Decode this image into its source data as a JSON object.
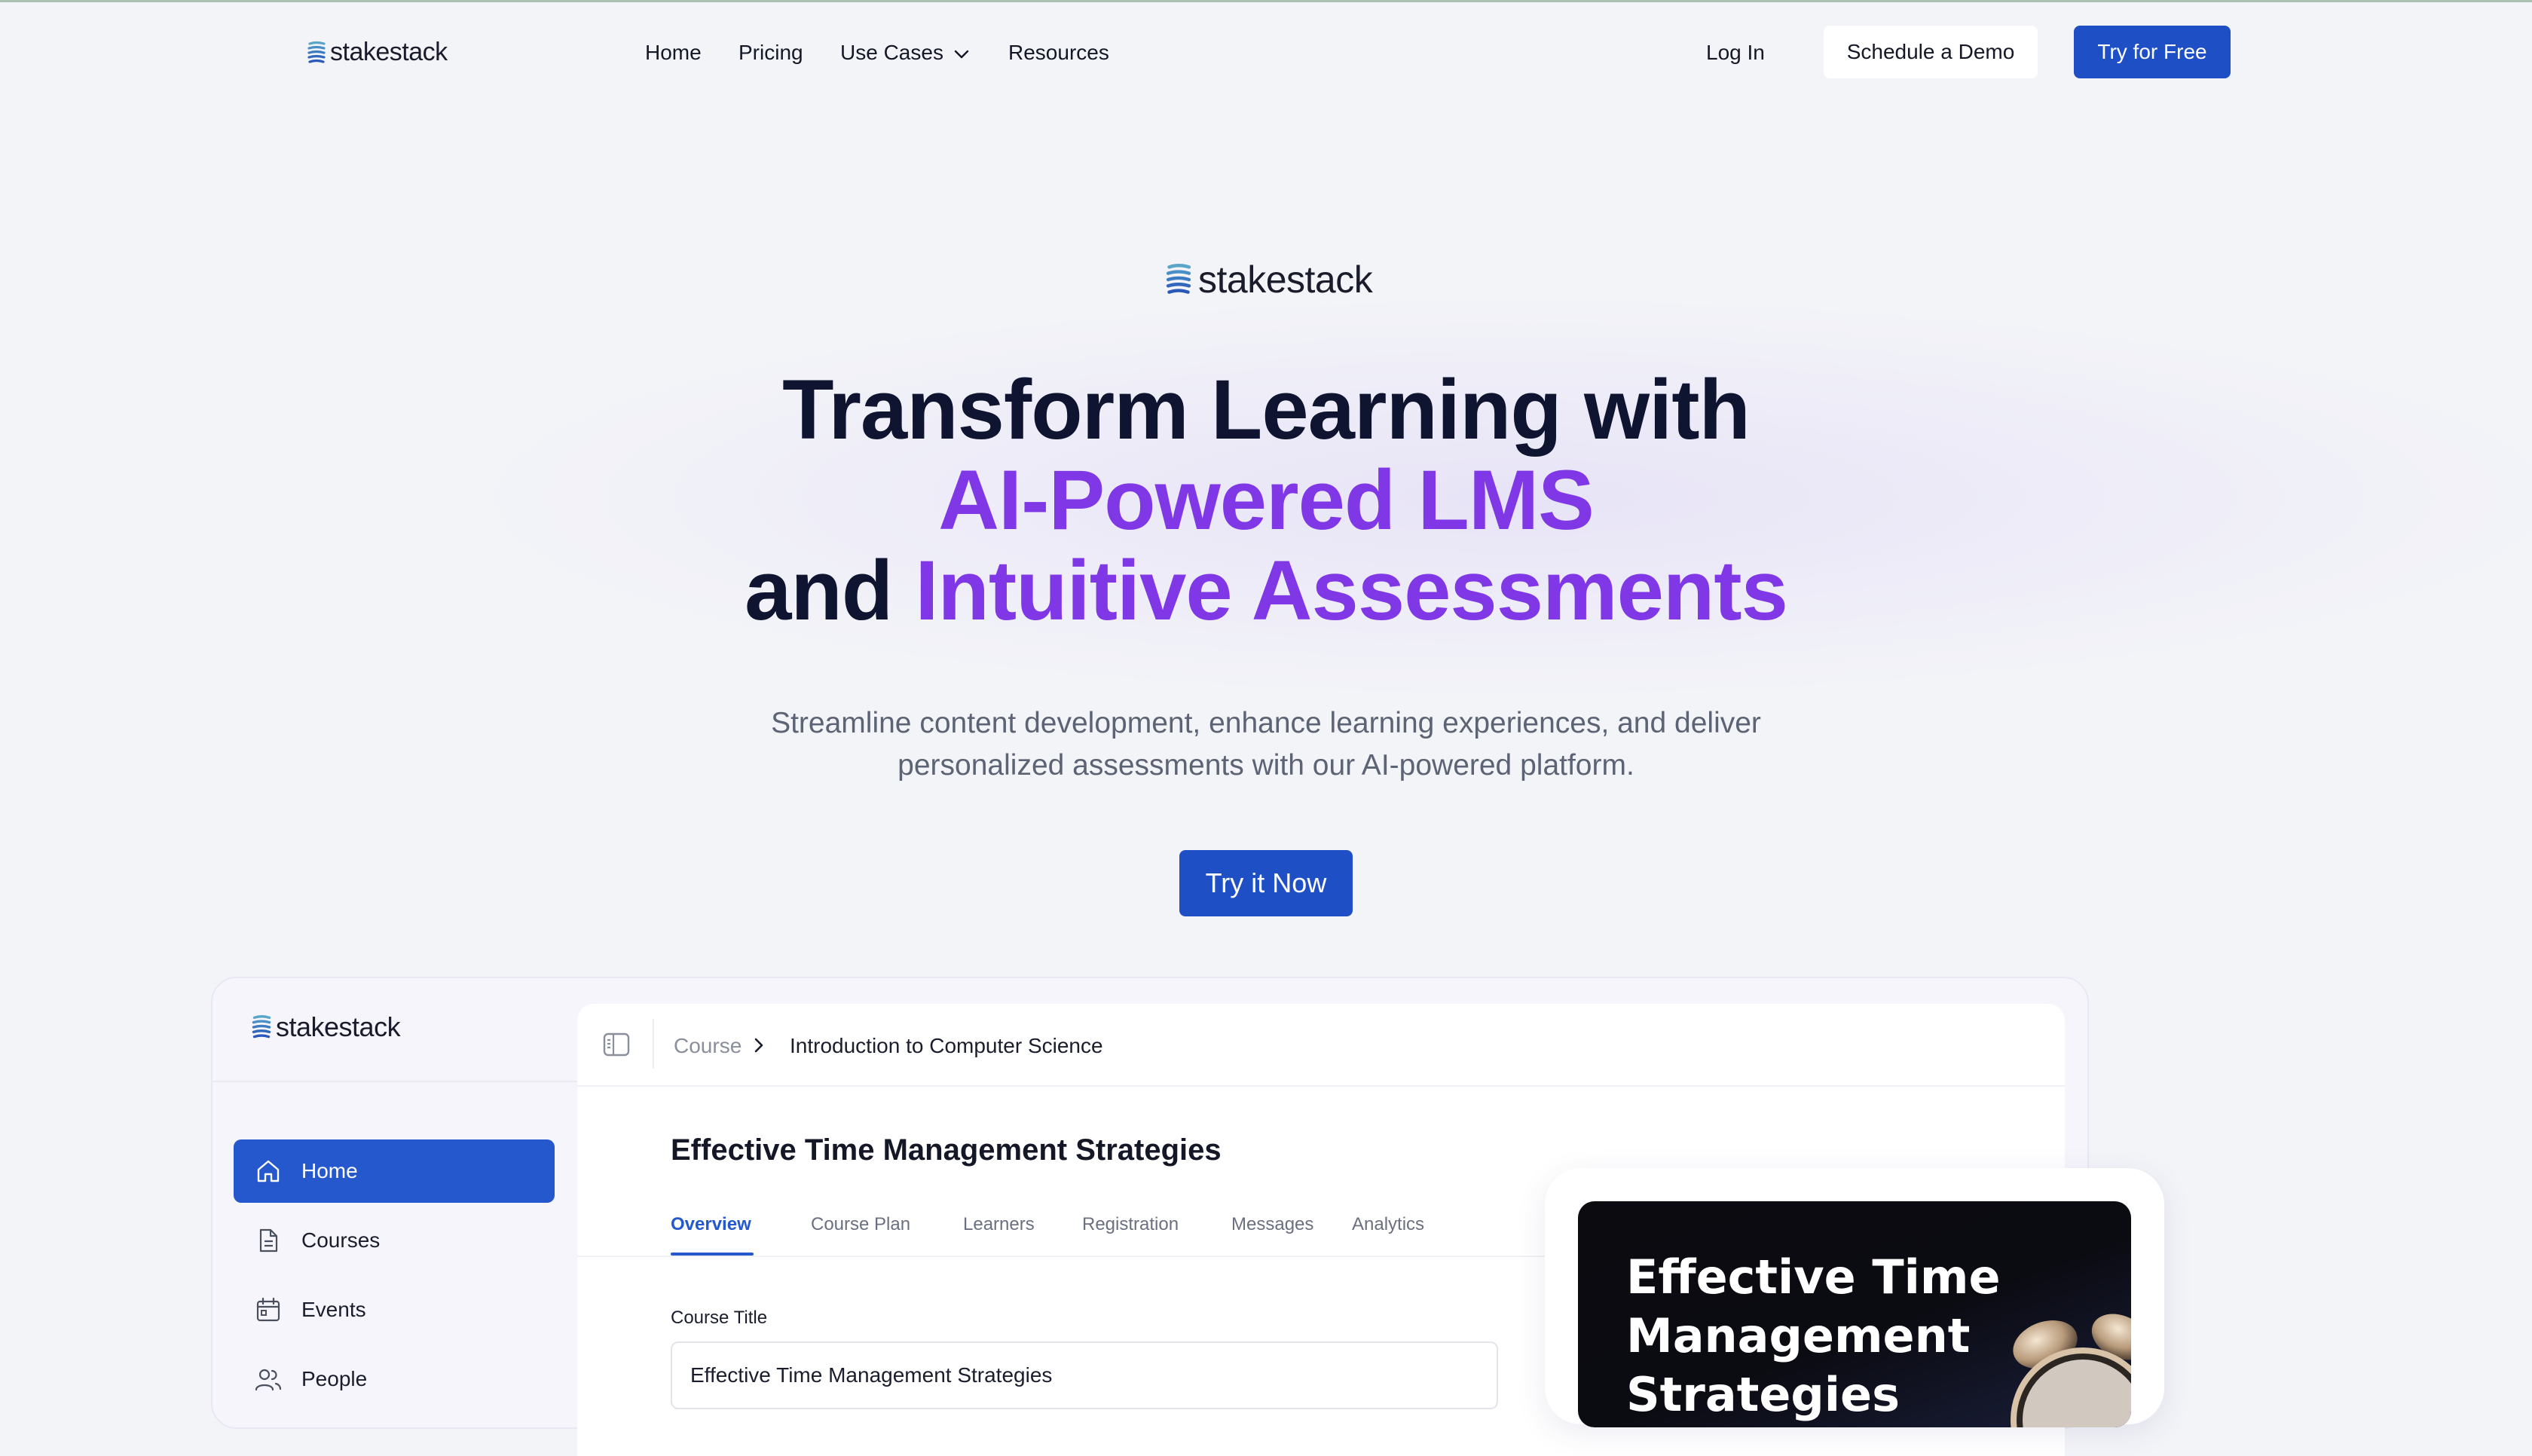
{
  "nav": {
    "brand": "stakestack",
    "links": [
      "Home",
      "Pricing",
      "Use Cases",
      "Resources"
    ],
    "login": "Log In",
    "demo_button": "Schedule a Demo",
    "free_button": "Try for Free"
  },
  "hero": {
    "brand": "stakestack",
    "headline_line1": "Transform Learning with",
    "headline_line2": "AI-Powered LMS",
    "headline_line3_plain": "and",
    "headline_line3_accent": "Intuitive Assessments",
    "subtext": "Streamline content development, enhance learning experiences, and deliver personalized assessments with our AI-powered platform.",
    "cta": "Try it Now"
  },
  "preview": {
    "brand": "stakestack",
    "sidebar": [
      {
        "label": "Home",
        "icon": "home-icon",
        "active": true
      },
      {
        "label": "Courses",
        "icon": "document-icon",
        "active": false
      },
      {
        "label": "Events",
        "icon": "calendar-icon",
        "active": false
      },
      {
        "label": "People",
        "icon": "people-icon",
        "active": false
      }
    ],
    "breadcrumb": {
      "parent": "Course",
      "current": "Introduction to Computer Science"
    },
    "course_title": "Effective Time Management Strategies",
    "tabs": [
      "Overview",
      "Course Plan",
      "Learners",
      "Registration",
      "Messages",
      "Analytics"
    ],
    "active_tab": "Overview",
    "field_label": "Course Title",
    "field_value": "Effective Time Management Strategies",
    "video_title": "Effective Time Management Strategies"
  },
  "colors": {
    "accent_blue": "#1f4fc4",
    "accent_purple": "#8037e6",
    "heading": "#0f1530",
    "background": "#f3f4f8"
  }
}
